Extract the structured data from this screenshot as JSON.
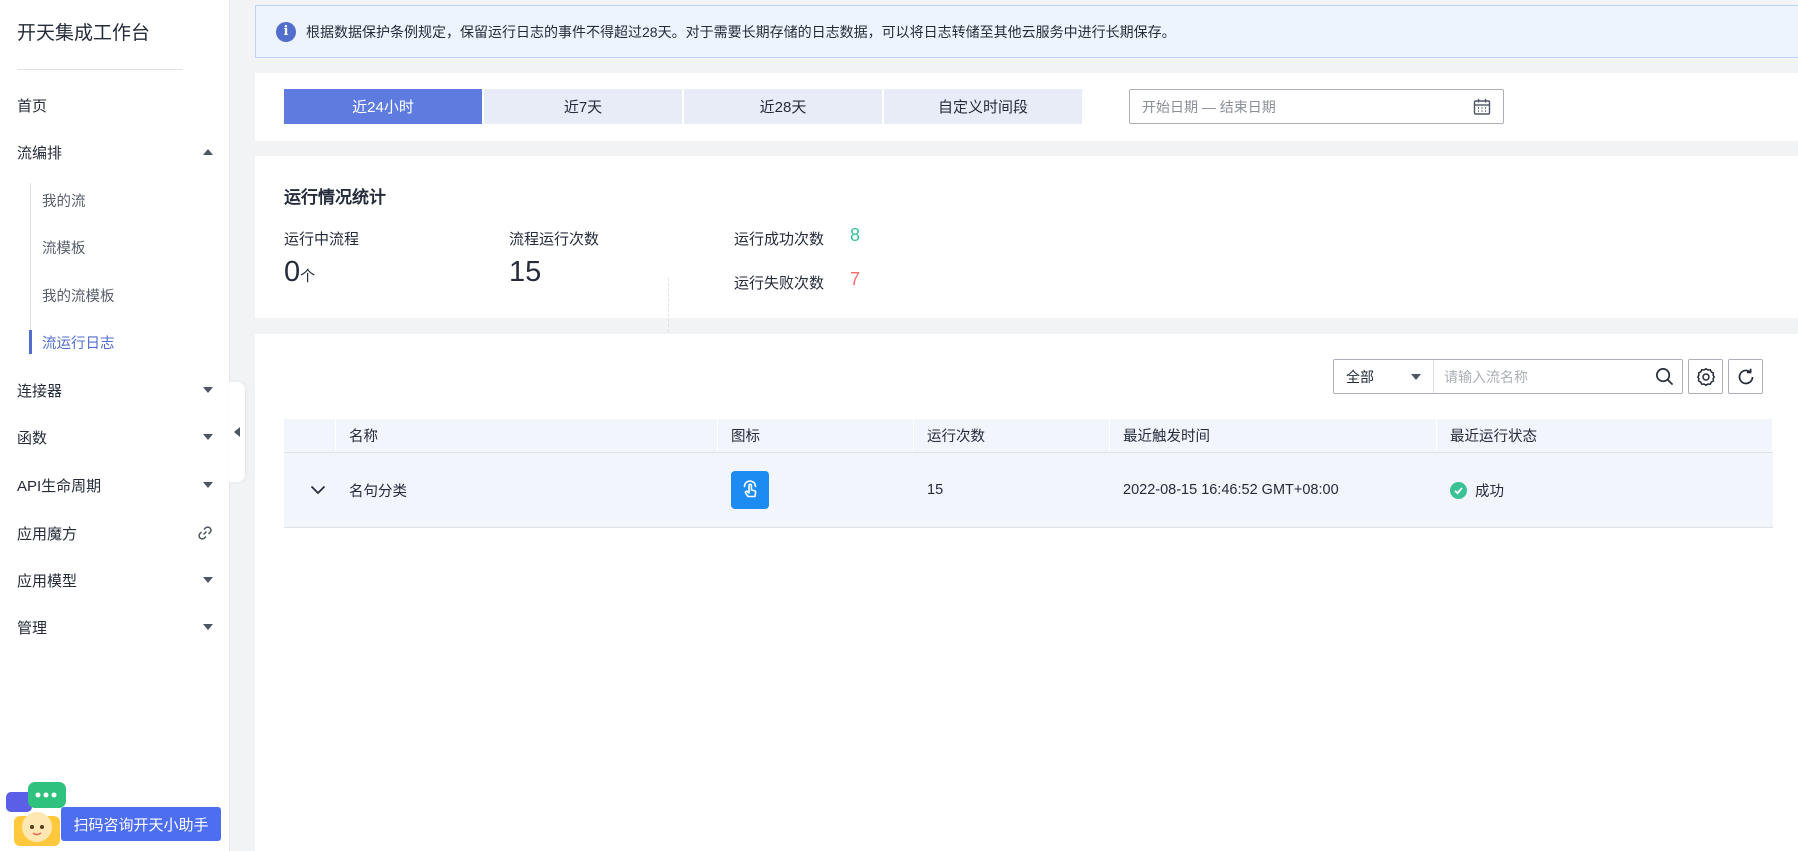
{
  "sidebar": {
    "title": "开天集成工作台",
    "items": [
      {
        "label": "首页"
      },
      {
        "label": "流编排"
      },
      {
        "label": "连接器"
      },
      {
        "label": "函数"
      },
      {
        "label": "API生命周期"
      },
      {
        "label": "应用魔方"
      },
      {
        "label": "应用模型"
      },
      {
        "label": "管理"
      }
    ],
    "sub_items": [
      {
        "label": "我的流"
      },
      {
        "label": "流模板"
      },
      {
        "label": "我的流模板"
      },
      {
        "label": "流运行日志",
        "active": true
      }
    ],
    "helper_label": "扫码咨询开天小助手"
  },
  "notice": {
    "text": "根据数据保护条例规定，保留运行日志的事件不得超过28天。对于需要长期存储的日志数据，可以将日志转储至其他云服务中进行长期保存。"
  },
  "time_filter": {
    "tabs": [
      {
        "label": "近24小时",
        "active": true
      },
      {
        "label": "近7天"
      },
      {
        "label": "近28天"
      },
      {
        "label": "自定义时间段"
      }
    ],
    "date_placeholder": "开始日期 — 结束日期"
  },
  "stats": {
    "title": "运行情况统计",
    "running_label": "运行中流程",
    "running_value": "0",
    "running_unit": "个",
    "runs_label": "流程运行次数",
    "runs_value": "15",
    "success_label": "运行成功次数",
    "success_value": "8",
    "fail_label": "运行失败次数",
    "fail_value": "7"
  },
  "colors": {
    "accent": "#5e7ce0",
    "success": "#3ac295",
    "danger": "#f66f6a"
  },
  "toolbar": {
    "filter_value": "全部",
    "search_placeholder": "请输入流名称"
  },
  "table": {
    "headers": {
      "name": "名称",
      "icon": "图标",
      "count": "运行次数",
      "time": "最近触发时间",
      "status": "最近运行状态"
    },
    "rows": [
      {
        "name": "名句分类",
        "icon": "touch-icon",
        "count": "15",
        "time": "2022-08-15 16:46:52 GMT+08:00",
        "status": "成功"
      }
    ]
  }
}
